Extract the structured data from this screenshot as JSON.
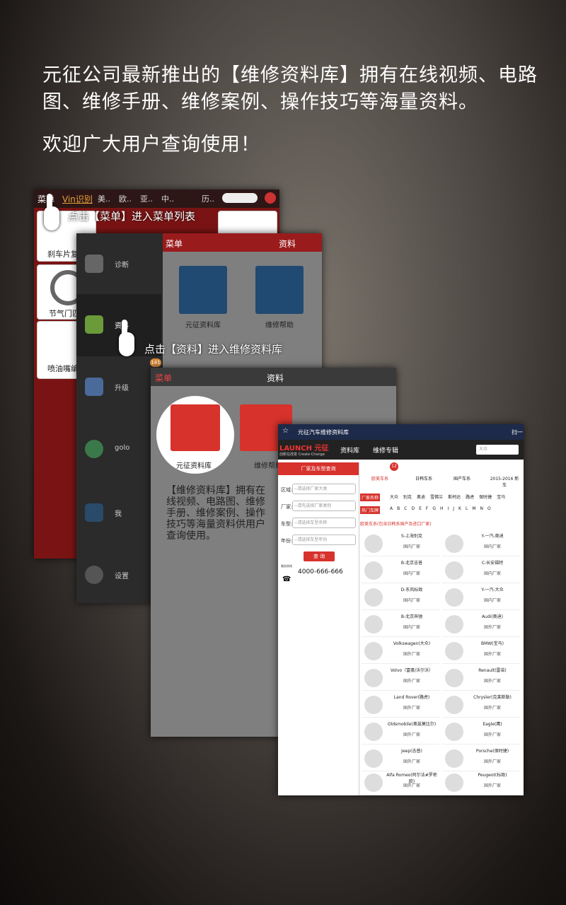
{
  "intro": "元征公司最新推出的【维修资料库】拥有在线视频、电路图、维修手册、维修案例、操作技巧等海量资料。",
  "welcome": "欢迎广大用户查询使用！",
  "shot1": {
    "tabs": [
      "菜单",
      "Vin识别",
      "美..",
      "欧..",
      "亚..",
      "中..",
      "历.."
    ],
    "tiles": [
      "刹车片复",
      "节气门匹",
      "喷油嘴编"
    ],
    "hint": "点击【菜单】进入菜单列表"
  },
  "shot2": {
    "menu_title": "菜单",
    "page_title": "资料",
    "menu_items": [
      "诊断",
      "资料",
      "升级",
      "golo",
      "我",
      "设置"
    ],
    "badge": "141",
    "icons": [
      "元征资料库",
      "维修帮助"
    ],
    "hint": "点击【资料】进入维修资料库"
  },
  "shot3": {
    "menu_title": "菜单",
    "page_title": "资料",
    "icons": [
      "元征资料库",
      "维修帮助"
    ],
    "caption": "【维修资料库】拥有在线视频、电路图、维修手册、维修案例、操作技巧等海量资料供用户查询使用。"
  },
  "shot4": {
    "tab_title": "元征汽车维修资料库",
    "scan": "扫一",
    "logo": "LAUNCH 元征",
    "slogan": "创新在改变 Create·Change",
    "nav": [
      "资料库",
      "维修专辑"
    ],
    "search_placeholder": "大众",
    "side_title": "厂家及车型查询",
    "fields": [
      {
        "label": "区域:",
        "placeholder": "--请选择厂家大类"
      },
      {
        "label": "厂家:",
        "placeholder": "--请先选择厂家类别"
      },
      {
        "label": "车型:",
        "placeholder": "--请选择车型名称"
      },
      {
        "label": "年份:",
        "placeholder": "--请选择车型年份"
      }
    ],
    "query_button": "查 询",
    "service_label": "服务热线",
    "phone": "4000-666-666",
    "categories": [
      "欧美车系",
      "日韩车系",
      "国产车系",
      "2015-2016 新车"
    ],
    "cat_badge": "12",
    "maker_label": "厂家名称",
    "makers": [
      "大众",
      "别克",
      "奥迪",
      "雪佛兰",
      "斯柯达",
      "路虎",
      "保时捷",
      "宝马"
    ],
    "hot_label": "热门车牌",
    "letters": [
      "A",
      "B",
      "C",
      "D",
      "E",
      "F",
      "G",
      "H",
      "I",
      "J",
      "K",
      "L",
      "M",
      "N",
      "O"
    ],
    "section": "欧美车系(包含日韩系国产及进口厂家)",
    "brands": [
      {
        "name": "S-上海别克",
        "sub": "国内厂家"
      },
      {
        "name": "Y-一汽-奥迪",
        "sub": "国内厂家"
      },
      {
        "name": "B-北京吉普",
        "sub": "国内厂家"
      },
      {
        "name": "C-长安福特",
        "sub": "国内厂家"
      },
      {
        "name": "D-东风标致",
        "sub": "国内厂家"
      },
      {
        "name": "Y-一汽-大众",
        "sub": "国内厂家"
      },
      {
        "name": "B-北京奔驰",
        "sub": "国内厂家"
      },
      {
        "name": "Audi(奥迪)",
        "sub": "国外厂家"
      },
      {
        "name": "Volkswagen(大众)",
        "sub": "国外厂家"
      },
      {
        "name": "BMW(宝马)",
        "sub": "国外厂家"
      },
      {
        "name": "Volvo（富豪/沃尔沃）",
        "sub": "国外厂家"
      },
      {
        "name": "Renault(雷诺)",
        "sub": "国外厂家"
      },
      {
        "name": "Land Rover(路虎)",
        "sub": "国外厂家"
      },
      {
        "name": "Chrysler(克莱斯勒)",
        "sub": "国外厂家"
      },
      {
        "name": "Oldsmobile(奥兹莫比尔)",
        "sub": "国外厂家"
      },
      {
        "name": "Eagle(鹰)",
        "sub": "国外厂家"
      },
      {
        "name": "Jeep(吉普)",
        "sub": "国外厂家"
      },
      {
        "name": "Porsche(保时捷)",
        "sub": "国外厂家"
      },
      {
        "name": "Alfa Romeo(阿尔法#罗密欧)",
        "sub": "国外厂家"
      },
      {
        "name": "Peugeot(标致)",
        "sub": "国外厂家"
      }
    ]
  },
  "colors": {
    "brand_red": "#d7322c",
    "menu_red": "#9a1b1c",
    "dark_blue": "#204a72"
  }
}
